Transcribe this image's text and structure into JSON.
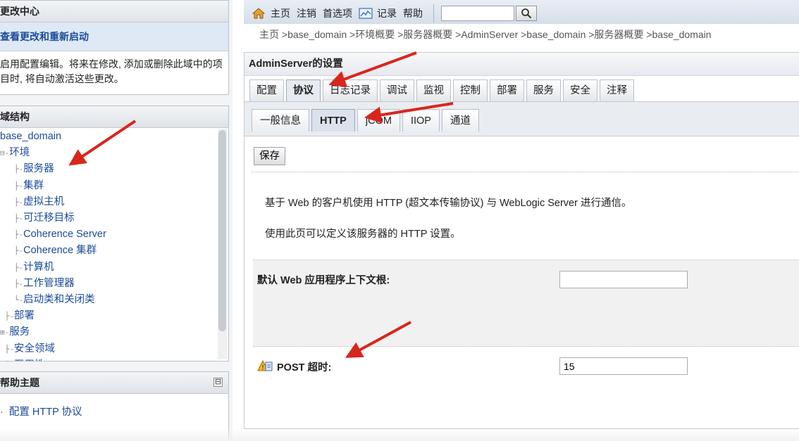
{
  "change_center": {
    "title": "更改中心",
    "link": "查看更改和重新启动",
    "message": "启用配置编辑。将来在修改, 添加或删除此域中的项目时, 将自动激活这些更改。"
  },
  "domain_structure": {
    "title": "域结构",
    "nodes": [
      {
        "prefix": "",
        "label": "base_domain"
      },
      {
        "prefix": "⊟-",
        "label": "环境"
      },
      {
        "prefix": "   ├-",
        "label": "服务器"
      },
      {
        "prefix": "   ├-",
        "label": "集群"
      },
      {
        "prefix": "   ├-",
        "label": "虚拟主机"
      },
      {
        "prefix": "   ├-",
        "label": "可迁移目标"
      },
      {
        "prefix": "   ├-",
        "label": "Coherence Server"
      },
      {
        "prefix": "   ├-",
        "label": "Coherence 集群"
      },
      {
        "prefix": "   ├-",
        "label": "计算机"
      },
      {
        "prefix": "   ├-",
        "label": "工作管理器"
      },
      {
        "prefix": "   └-",
        "label": "启动类和关闭类"
      },
      {
        "prefix": " ├-",
        "label": "部署"
      },
      {
        "prefix": "⊞-",
        "label": "服务"
      },
      {
        "prefix": " ├-",
        "label": "安全领域"
      },
      {
        "prefix": " ├-",
        "label": "互用性"
      }
    ]
  },
  "help_topics": {
    "title": "帮助主题",
    "item": "配置 HTTP 协议",
    "collapse_symbol": "⊟"
  },
  "toolbar": {
    "home": "主页",
    "logout": "注销",
    "preferences": "首选项",
    "record": "记录",
    "help": "帮助",
    "search_value": ""
  },
  "breadcrumb": "主页 >base_domain >环境概要 >服务器概要 >AdminServer >base_domain >服务器概要 >base_domain",
  "content": {
    "title": "AdminServer的设置",
    "tabs": [
      "配置",
      "协议",
      "日志记录",
      "调试",
      "监视",
      "控制",
      "部署",
      "服务",
      "安全",
      "注释"
    ],
    "active_tab": "协议",
    "subtabs": [
      "一般信息",
      "HTTP",
      "jCOM",
      "IIOP",
      "通道"
    ],
    "active_subtab": "HTTP",
    "save_label": "保存",
    "desc1": "基于 Web 的客户机使用 HTTP (超文本传输协议) 与 WebLogic Server 进行通信。",
    "desc2": "使用此页可以定义该服务器的 HTTP 设置。",
    "field_root_label": "默认 Web 应用程序上下文根:",
    "field_root_value": "",
    "field_post_label": "POST 超时:",
    "field_post_value": "15"
  },
  "colors": {
    "link": "#1b4b9a",
    "arrow": "#d8261c"
  }
}
